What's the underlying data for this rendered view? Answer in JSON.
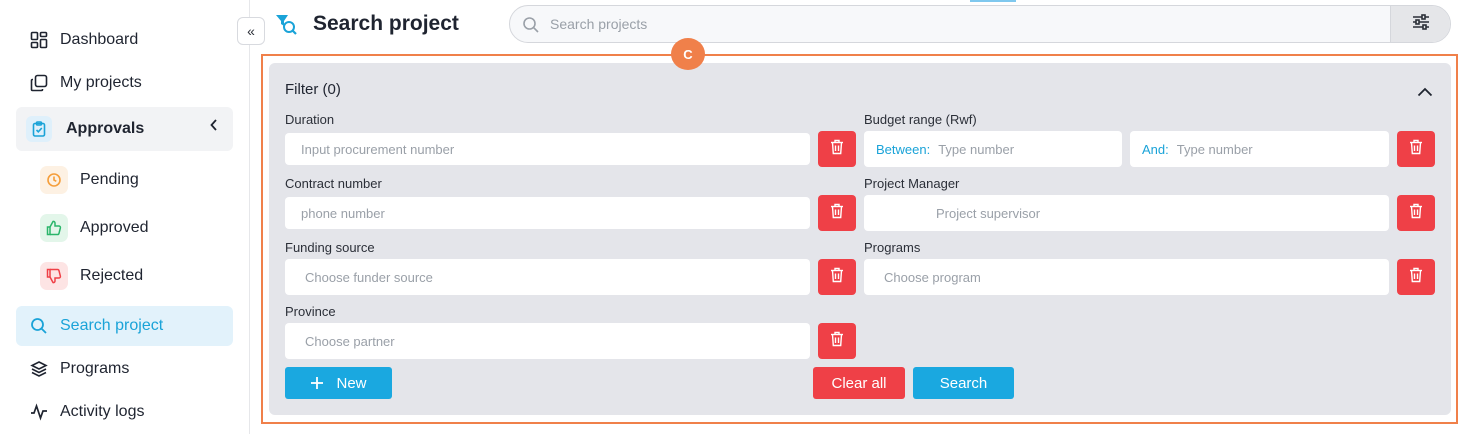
{
  "sidebar": {
    "items": [
      {
        "label": "Dashboard",
        "icon": "dashboard-icon"
      },
      {
        "label": "My projects",
        "icon": "copy-icon"
      },
      {
        "label": "Approvals",
        "icon": "clipboard-check-icon"
      },
      {
        "label": "Search project",
        "icon": "search-icon"
      },
      {
        "label": "Programs",
        "icon": "layers-icon"
      },
      {
        "label": "Activity logs",
        "icon": "activity-icon"
      }
    ],
    "approvals_sub": [
      {
        "label": "Pending",
        "icon": "clock-icon",
        "color": "#f59e3b"
      },
      {
        "label": "Approved",
        "icon": "thumbs-up-icon",
        "color": "#2bb56a"
      },
      {
        "label": "Rejected",
        "icon": "thumbs-down-icon",
        "color": "#ef4047"
      }
    ],
    "collapse_glyph": "«"
  },
  "header": {
    "title": "Search project",
    "search_placeholder": "Search projects"
  },
  "annotation": {
    "label": "C",
    "color": "#f0804a"
  },
  "filter": {
    "title": "Filter (0)",
    "fields": {
      "duration": {
        "label": "Duration",
        "placeholder": "Input procurement number"
      },
      "contract": {
        "label": "Contract number",
        "placeholder": "phone number"
      },
      "funding": {
        "label": "Funding source",
        "placeholder": "Choose funder source"
      },
      "province": {
        "label": "Province",
        "placeholder": "Choose partner"
      },
      "budget": {
        "label": "Budget range (Rwf)",
        "between_prefix": "Between:",
        "between_placeholder": "Type number",
        "and_prefix": "And:",
        "and_placeholder": "Type number"
      },
      "manager": {
        "label": "Project Manager",
        "placeholder": "Project supervisor"
      },
      "programs": {
        "label": "Programs",
        "placeholder": "Choose program"
      }
    },
    "buttons": {
      "new": "New",
      "clear": "Clear all",
      "search": "Search"
    }
  },
  "colors": {
    "accent": "#1aa8e0",
    "danger": "#ef4047",
    "panel": "#e4e5ea"
  }
}
